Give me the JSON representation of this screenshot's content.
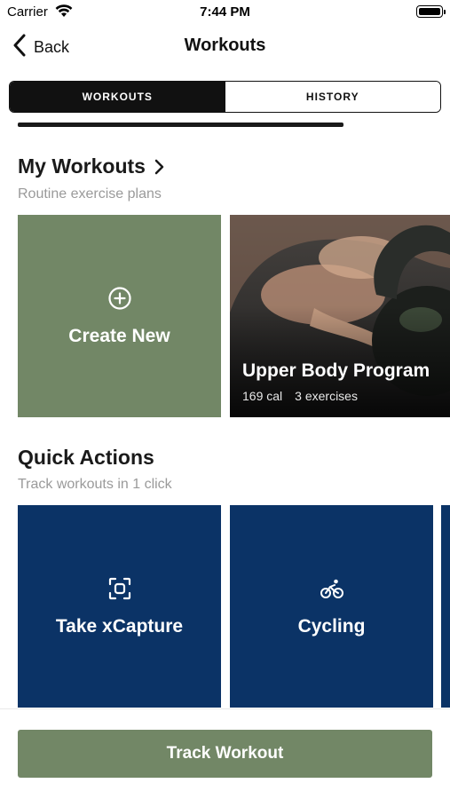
{
  "status_bar": {
    "carrier": "Carrier",
    "time": "7:44 PM"
  },
  "nav": {
    "back_label": "Back",
    "title": "Workouts"
  },
  "tabs": [
    {
      "label": "WORKOUTS",
      "active": true
    },
    {
      "label": "HISTORY",
      "active": false
    }
  ],
  "my_workouts": {
    "title": "My Workouts",
    "subtitle": "Routine exercise plans",
    "create_new_label": "Create New",
    "program": {
      "title": "Upper Body Program",
      "calories": "169 cal",
      "exercises": "3 exercises"
    }
  },
  "quick_actions": {
    "title": "Quick Actions",
    "subtitle": "Track workouts in 1 click",
    "items": [
      {
        "label": "Take xCapture",
        "icon": "capture-icon"
      },
      {
        "label": "Cycling",
        "icon": "cycling-icon"
      }
    ]
  },
  "track_workout_label": "Track Workout",
  "colors": {
    "sage": "#728766",
    "navy": "#0b3366",
    "black": "#111111"
  }
}
